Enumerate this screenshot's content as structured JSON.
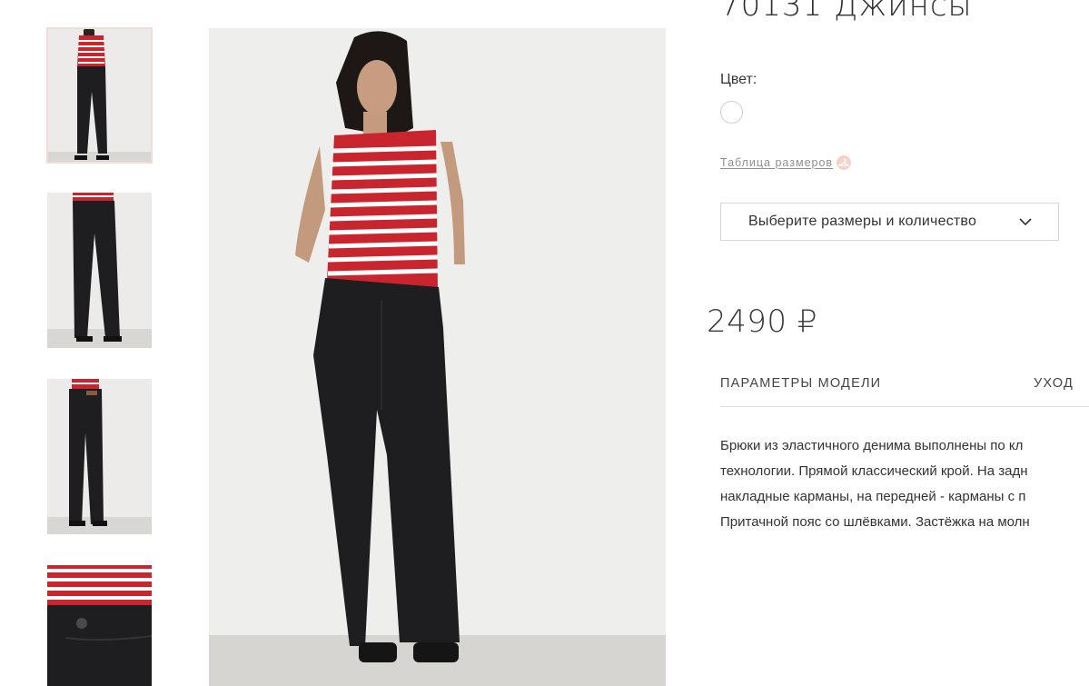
{
  "product": {
    "title": "70131 Джинсы",
    "color_label": "Цвет:",
    "color_swatch": "#ffffff",
    "size_chart_link": "Таблица размеров",
    "size_select_label": "Выберите размеры и количество",
    "price": "2490 ₽"
  },
  "tabs": [
    {
      "label": "ПАРАМЕТРЫ МОДЕЛИ"
    },
    {
      "label": "УХОД"
    }
  ],
  "description_lines": [
    "Брюки из эластичного денима выполнены по кл",
    "технологии. Прямой классический крой. На задн",
    "накладные карманы, на передней - карманы с п",
    "Притачной пояс со шлёвками. Застёжка на молн"
  ],
  "colors": {
    "stripe_red": "#c9252f",
    "denim_black": "#1e1e20",
    "background": "#eeeeec",
    "floor": "#d6d5d1",
    "accent_pink": "#f1ddd7"
  },
  "gallery": {
    "thumbnails": [
      {
        "label": "front-full-view"
      },
      {
        "label": "front-waist-down"
      },
      {
        "label": "back-view"
      },
      {
        "label": "waistband-detail"
      }
    ]
  }
}
